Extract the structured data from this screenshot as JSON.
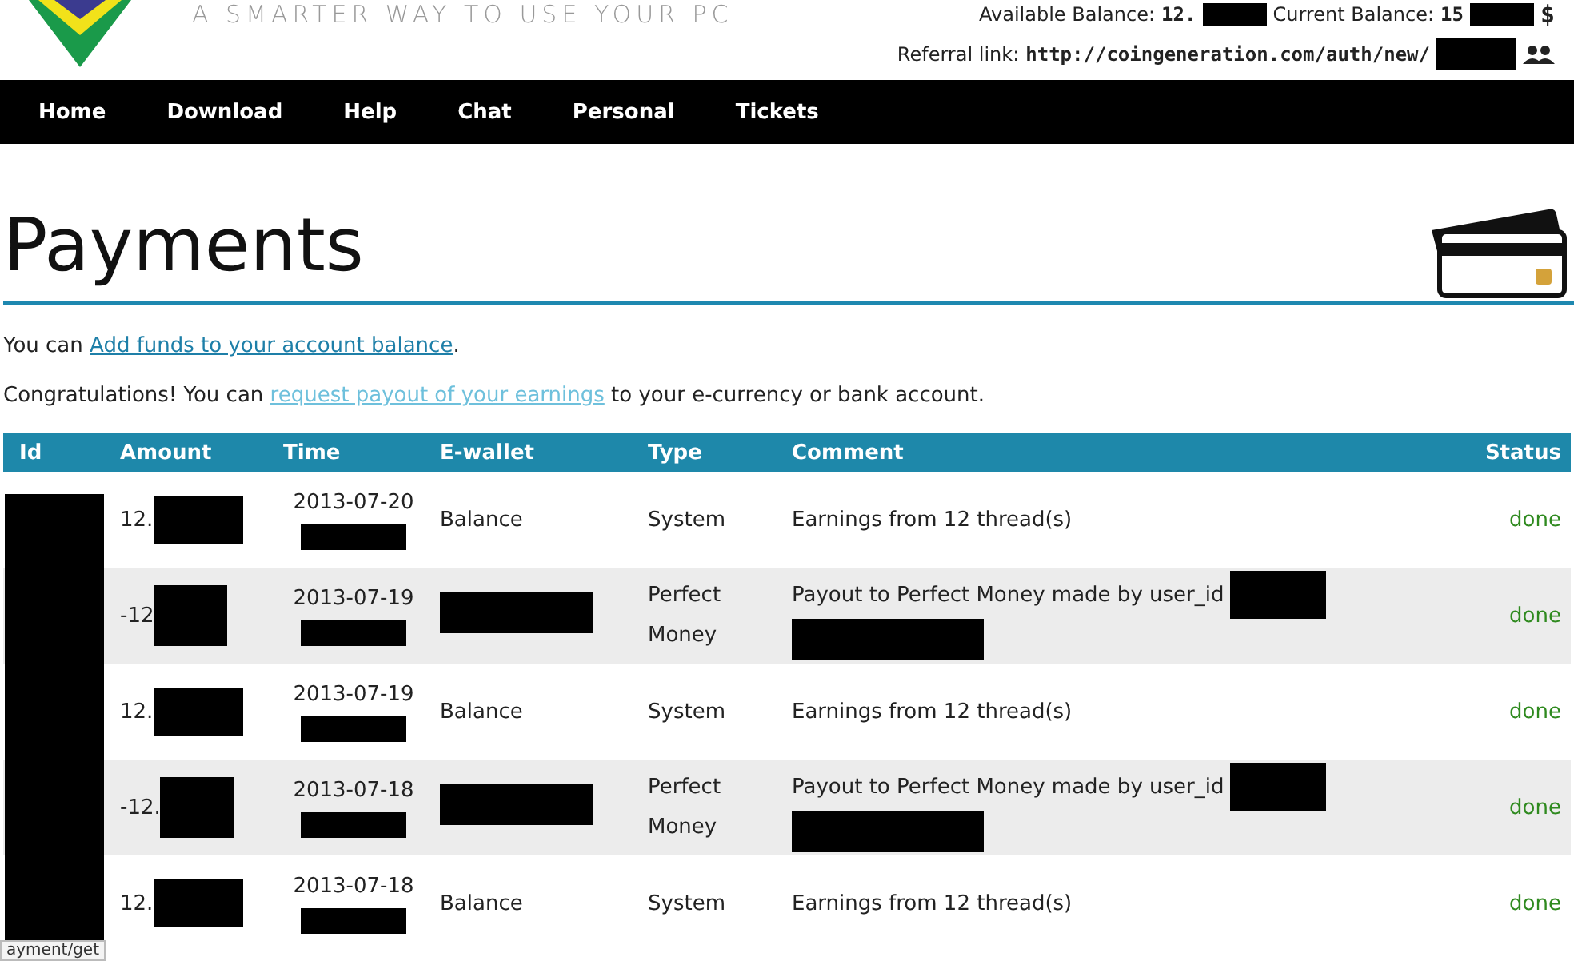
{
  "header": {
    "tagline": "A SMARTER WAY TO USE YOUR PC",
    "available_label": "Available Balance:",
    "available_value": "12.",
    "current_label": "Current Balance:",
    "current_value": "15",
    "currency": "$",
    "referral_label": "Referral link:",
    "referral_url": "http://coingeneration.com/auth/new/"
  },
  "nav": [
    {
      "label": "Home"
    },
    {
      "label": "Download"
    },
    {
      "label": "Help"
    },
    {
      "label": "Chat"
    },
    {
      "label": "Personal"
    },
    {
      "label": "Tickets"
    }
  ],
  "title": "Payments",
  "intro": [
    {
      "before": "You can ",
      "link": "Add funds to your account balance",
      "after": ".",
      "kind": "dark"
    },
    {
      "before": "Congratulations! You can ",
      "link": "request payout of your earnings",
      "after": " to your e-currency or bank account.",
      "kind": "light"
    }
  ],
  "table": {
    "columns": [
      "Id",
      "Amount",
      "Time",
      "E-wallet",
      "Type",
      "Comment",
      "Status"
    ],
    "rows": [
      {
        "amount": "12.",
        "time": "2013-07-20",
        "ewallet": "Balance",
        "type": "System",
        "comment": "Earnings from 12 thread(s)",
        "status": "done",
        "kind": "earning"
      },
      {
        "amount": "-12",
        "time": "2013-07-19",
        "type": "Perfect Money",
        "comment": "Payout to Perfect Money made by user_id",
        "status": "done",
        "kind": "payout"
      },
      {
        "amount": "12.",
        "time": "2013-07-19",
        "ewallet": "Balance",
        "type": "System",
        "comment": "Earnings from 12 thread(s)",
        "status": "done",
        "kind": "earning"
      },
      {
        "amount": "-12.",
        "time": "2013-07-18",
        "type": "Perfect Money",
        "comment": "Payout to Perfect Money made by user_id",
        "status": "done",
        "kind": "payout"
      },
      {
        "amount": "12.",
        "time": "2013-07-18",
        "ewallet": "Balance",
        "type": "System",
        "comment": "Earnings from 12 thread(s)",
        "status": "done",
        "kind": "earning"
      }
    ]
  },
  "status_bar": "ayment/get"
}
